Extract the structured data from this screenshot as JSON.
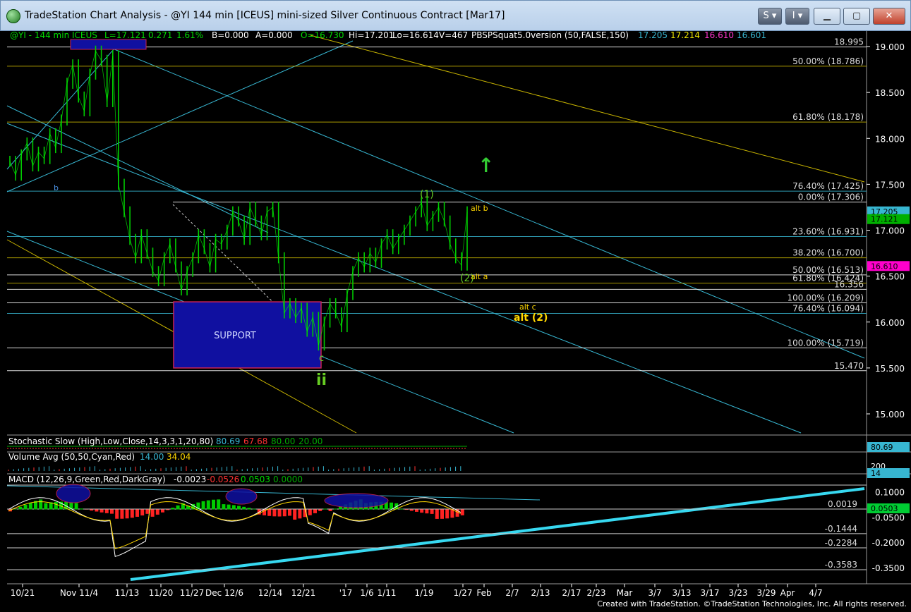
{
  "window": {
    "title": "TradeStation Chart Analysis - @YI 144 min [ICEUS] mini-sized Silver Continuous Contract [Mar17]",
    "btn_s": "S",
    "btn_i": "I"
  },
  "colors": {
    "background": "#000000",
    "price": "#00cc00",
    "cyan_line": "#37b6d1",
    "yellow_line": "#c8b400",
    "support_box": "#1010a0",
    "green_label": "#66cc22",
    "yellow_label": "#ffd700"
  },
  "header": {
    "symbol": "@YI - 144 min  ICEUS",
    "last": "L=17.121",
    "change": "0.271",
    "change_pct": "1.61%",
    "bid": "B=0.000",
    "ask": "A=0.000",
    "open": "O=16.730",
    "high": "Hi=17.201",
    "low": "Lo=16.614",
    "volume": "V=467",
    "study": "PBSPSquat5.0version (50,FALSE,150)",
    "study_v1": "17.205",
    "study_v2": "17.214",
    "study_v3": "16.610",
    "study_v4": "16.601"
  },
  "chart_data": [
    {
      "type": "line",
      "panel": "price",
      "ylim": [
        14.75,
        19.15
      ],
      "y_ticks": [
        "19.000",
        "18.500",
        "18.000",
        "17.500",
        "17.000",
        "16.500",
        "16.000",
        "15.500",
        "15.000"
      ],
      "x_ticks": [
        "10/21",
        "Nov 11/4",
        "11/13",
        "11/20",
        "11/27",
        "Dec 12/6",
        "12/14",
        "12/21",
        "'17",
        "1/6",
        "1/11",
        "1/19",
        "1/27",
        "Feb",
        "2/7",
        "2/13",
        "2/17",
        "2/23",
        "Mar",
        "3/7",
        "3/13",
        "3/17",
        "3/23",
        "3/29",
        "Apr",
        "4/7"
      ],
      "series": [
        {
          "values": [
            17.75,
            17.6,
            17.82,
            17.95,
            17.7,
            17.85,
            17.78,
            18.05,
            17.9,
            18.2,
            18.6,
            18.8,
            18.45,
            18.3,
            18.7,
            18.95,
            18.85,
            18.4,
            18.9,
            17.5,
            17.2,
            16.9,
            16.7,
            16.95,
            16.75,
            16.55,
            16.45,
            16.7,
            16.85,
            16.6,
            16.35,
            16.55,
            16.7,
            16.95,
            16.8,
            16.6,
            16.9,
            16.85,
            17.0,
            17.2,
            17.1,
            16.9,
            17.25,
            17.1,
            16.95,
            17.2,
            17.25,
            16.7,
            16.1,
            16.2,
            16.05,
            16.15,
            15.9,
            16.05,
            15.75,
            16.0,
            16.2,
            16.1,
            15.95,
            16.3,
            16.55,
            16.7,
            16.6,
            16.75,
            16.65,
            16.85,
            16.95,
            16.8,
            16.9,
            17.0,
            17.1,
            17.2,
            17.3,
            17.05,
            17.15,
            17.25,
            17.1,
            16.85,
            16.7,
            16.62,
            17.2
          ]
        }
      ],
      "support_box": {
        "label": "SUPPORT",
        "y_top": 16.22,
        "y_bottom": 15.5
      },
      "fib_levels": [
        {
          "label": "50.00% (18.786)",
          "value": 18.786
        },
        {
          "label": "61.80% (18.178)",
          "value": 18.178
        },
        {
          "label": "76.40% (17.425)",
          "value": 17.425
        },
        {
          "label": "0.00% (17.306)",
          "value": 17.306
        },
        {
          "label": "23.60% (16.931)",
          "value": 16.931
        },
        {
          "label": "38.20% (16.700)",
          "value": 16.7
        },
        {
          "label": "50.00% (16.513)",
          "value": 16.513
        },
        {
          "label": "61.80% (16.424)",
          "value": 16.424
        },
        {
          "label": "100.00% (16.209)",
          "value": 16.209
        },
        {
          "label": "76.40% (16.094)",
          "value": 16.094
        },
        {
          "label": "100.00% (15.719)",
          "value": 15.719
        },
        {
          "label": "15.470",
          "value": 15.47
        },
        {
          "label": "16.356",
          "value": 16.356
        },
        {
          "label": "18.995",
          "value": 18.995
        }
      ],
      "price_tags": [
        {
          "label": "17.205",
          "value": 17.205,
          "color": "#37b6d1"
        },
        {
          "label": "17.121",
          "value": 17.121,
          "color": "#00b000"
        },
        {
          "label": "16.610",
          "value": 16.61,
          "color": "#ff00cc"
        }
      ],
      "annotations": [
        {
          "text": "(1)",
          "color": "#66cc22"
        },
        {
          "text": "(2)",
          "color": "#66cc22"
        },
        {
          "text": "alt b",
          "color": "#ffd700"
        },
        {
          "text": "alt a",
          "color": "#ffd700"
        },
        {
          "text": "alt c",
          "color": "#ffd700"
        },
        {
          "text": "alt (2)",
          "color": "#ffd700"
        },
        {
          "text": "b",
          "color": "#4a90e2"
        },
        {
          "text": "c",
          "color": "#66cc22"
        },
        {
          "text": "ii",
          "color": "#66cc22"
        },
        {
          "text": "↑",
          "color": "#33cc33"
        }
      ]
    },
    {
      "type": "line",
      "panel": "stochastic",
      "title": "Stochastic Slow (High,Low,Close,14,3,3,1,20,80)",
      "values_shown": [
        "80.69",
        "67.68",
        "80.00",
        "20.00"
      ],
      "tag": "80.69"
    },
    {
      "type": "bar",
      "panel": "volume",
      "title": "Volume Avg (50,50,Cyan,Red)",
      "values_shown": [
        "14.00",
        "34.04"
      ],
      "tag_top": "200",
      "tag": "14"
    },
    {
      "type": "bar",
      "panel": "macd",
      "title": "MACD (12,26,9,Green,Red,DarkGray)",
      "values_shown": [
        "-0.0023",
        "-0.0526",
        "0.0503",
        "0.0000"
      ],
      "ylim": [
        -0.38,
        0.16
      ],
      "y_ticks": [
        "0.1000",
        "-0.0500",
        "-0.2000",
        "-0.3500"
      ],
      "levels": [
        {
          "label": "0.0019",
          "value": 0.0019
        },
        {
          "label": "-0.1444",
          "value": -0.1444
        },
        {
          "label": "-0.2284",
          "value": -0.2284
        },
        {
          "label": "-0.3583",
          "value": -0.3583
        }
      ],
      "tag": "0.0503"
    }
  ],
  "footer": "Created with TradeStation. ©TradeStation Technologies, Inc. All rights reserved."
}
